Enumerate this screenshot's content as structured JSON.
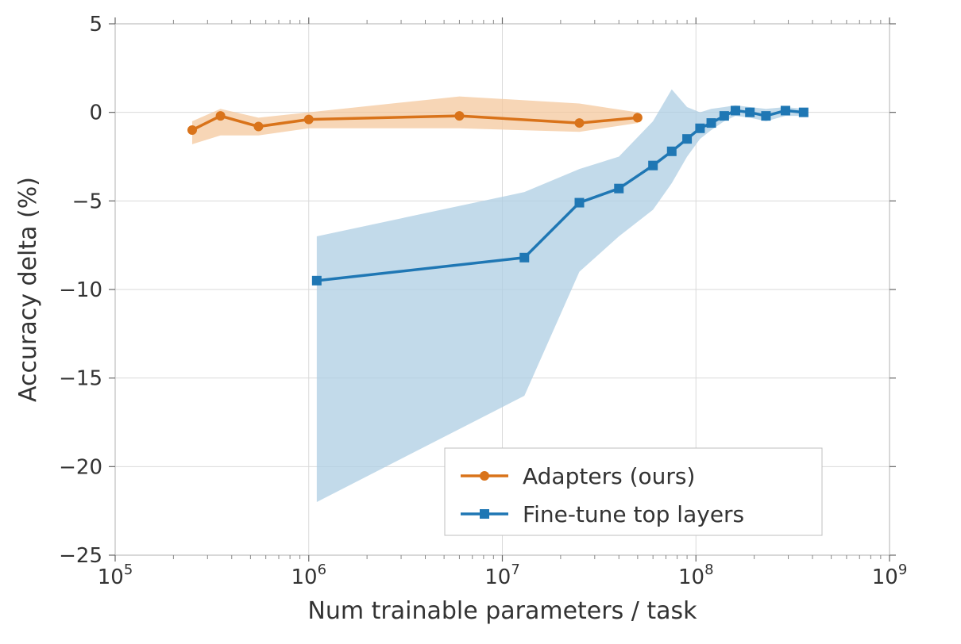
{
  "chart_data": {
    "type": "line",
    "xlabel": "Num trainable parameters / task",
    "ylabel": "Accuracy delta (%)",
    "xscale": "log",
    "xlim": [
      100000,
      1000000000
    ],
    "ylim": [
      -25,
      5
    ],
    "xticks_exp": [
      5,
      6,
      7,
      8,
      9
    ],
    "yticks": [
      5,
      0,
      -5,
      -10,
      -15,
      -20,
      -25
    ],
    "colors": {
      "adapters": "#d9731a",
      "finetune": "#1f77b4",
      "adapters_fill": "#f4c89d",
      "finetune_fill": "#aecde3"
    },
    "legend": {
      "position": "bottom-right",
      "entries": [
        {
          "key": "adapters",
          "label": "Adapters (ours)",
          "marker": "circle"
        },
        {
          "key": "finetune",
          "label": "Fine-tune top layers",
          "marker": "square"
        }
      ]
    },
    "series": [
      {
        "name": "Adapters (ours)",
        "key": "adapters",
        "marker": "circle",
        "x": [
          250000,
          350000,
          550000,
          1000000,
          6000000,
          25000000,
          50000000
        ],
        "y": [
          -1.0,
          -0.2,
          -0.8,
          -0.4,
          -0.2,
          -0.6,
          -0.3
        ],
        "y_low": [
          -1.8,
          -1.3,
          -1.3,
          -0.9,
          -0.9,
          -1.1,
          -0.6
        ],
        "y_high": [
          -0.5,
          0.2,
          -0.3,
          0.0,
          0.9,
          0.5,
          0.0
        ]
      },
      {
        "name": "Fine-tune top layers",
        "key": "finetune",
        "marker": "square",
        "x": [
          1100000,
          13000000,
          25000000,
          40000000,
          60000000,
          75000000,
          90000000,
          105000000,
          120000000,
          140000000,
          160000000,
          190000000,
          230000000,
          290000000,
          360000000
        ],
        "y": [
          -9.5,
          -8.2,
          -5.1,
          -4.3,
          -3.0,
          -2.2,
          -1.5,
          -0.9,
          -0.6,
          -0.2,
          0.1,
          0.0,
          -0.2,
          0.1,
          0.0
        ],
        "y_low": [
          -22.0,
          -16.0,
          -9.0,
          -7.0,
          -5.5,
          -4.0,
          -2.5,
          -1.5,
          -1.0,
          -0.5,
          -0.2,
          -0.3,
          -0.5,
          -0.2,
          -0.2
        ],
        "y_high": [
          -7.0,
          -4.5,
          -3.2,
          -2.5,
          -0.5,
          1.3,
          0.3,
          0.0,
          0.2,
          0.3,
          0.4,
          0.3,
          0.2,
          0.3,
          0.2
        ]
      }
    ]
  }
}
